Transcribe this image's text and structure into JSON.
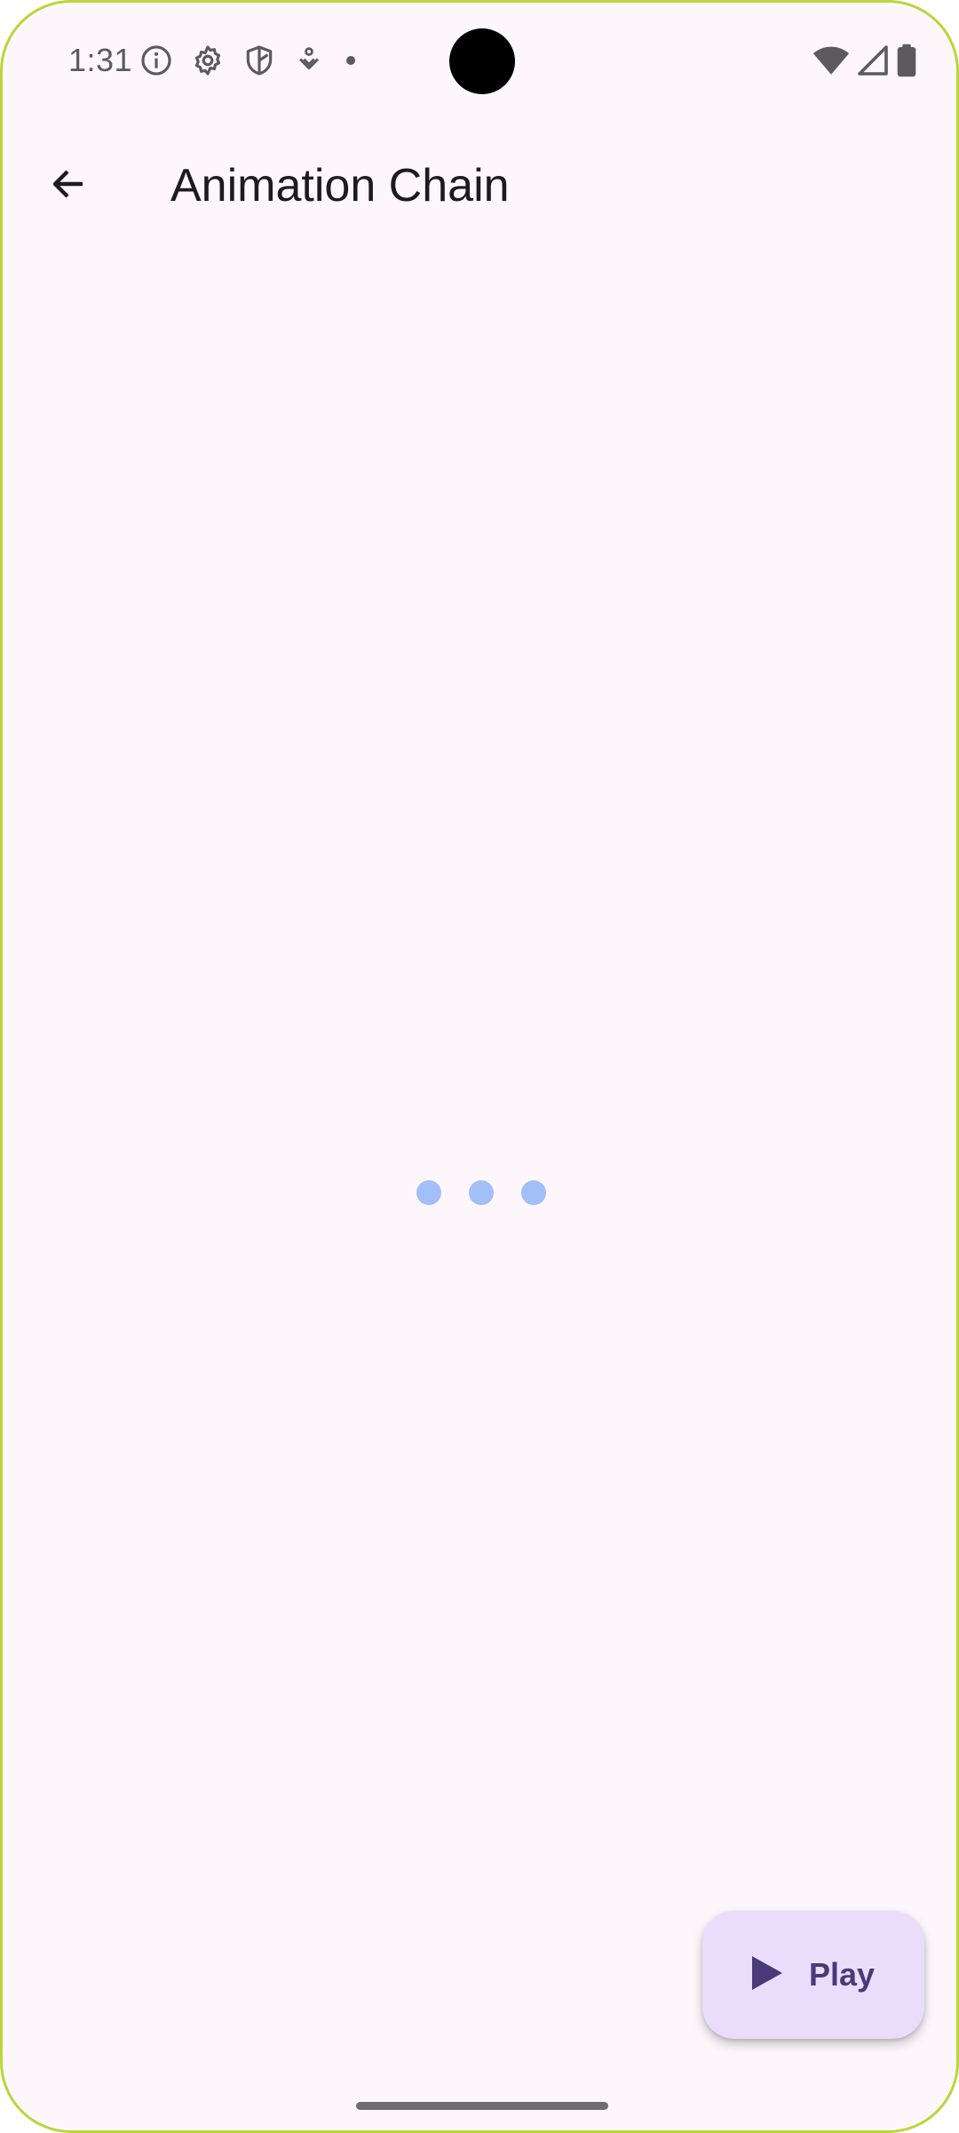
{
  "status_bar": {
    "time": "1:31",
    "left_icons": [
      "info-icon",
      "gear-icon",
      "shield-icon",
      "download-icon",
      "notification-dot-icon"
    ],
    "right_icons": [
      "wifi-icon",
      "signal-icon",
      "battery-icon"
    ]
  },
  "app_bar": {
    "back_icon": "arrow-back-icon",
    "title": "Animation Chain"
  },
  "loading": {
    "dot_count": 3,
    "dot_color": "#a2bff8"
  },
  "fab": {
    "icon": "play-icon",
    "label": "Play",
    "background": "#eaddfb",
    "foreground": "#4a3a78"
  },
  "colors": {
    "background": "#fdf7fc",
    "frame_border": "#b9d63a"
  }
}
